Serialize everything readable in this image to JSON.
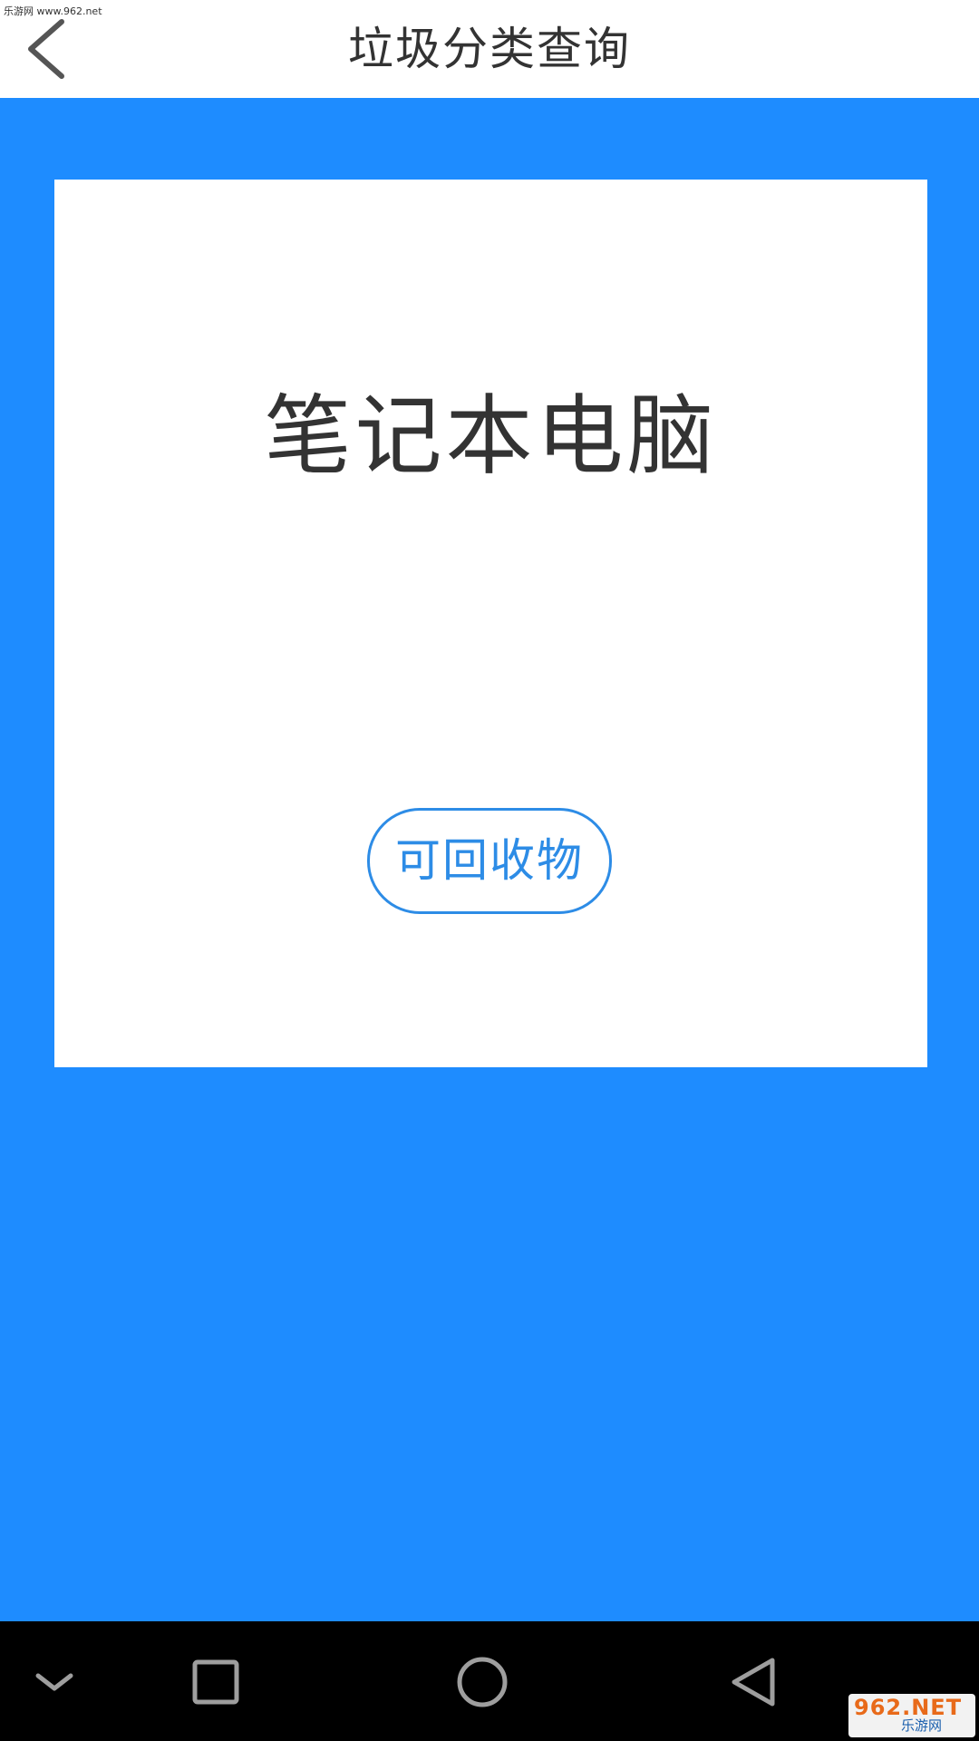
{
  "watermark": {
    "top_text": "乐游网 www.962.net",
    "logo_main": "962.NET",
    "logo_sub": "乐游网"
  },
  "header": {
    "title": "垃圾分类查询",
    "back_icon": "chevron-left-icon"
  },
  "result": {
    "item_name": "笔记本电脑",
    "category_label": "可回收物"
  },
  "system_nav": {
    "icons": [
      "chevron-down-icon",
      "recents-square-icon",
      "home-circle-icon",
      "back-triangle-icon"
    ]
  },
  "colors": {
    "background_blue": "#1e8cff",
    "accent": "#2d8ce6",
    "text_dark": "#333333"
  }
}
